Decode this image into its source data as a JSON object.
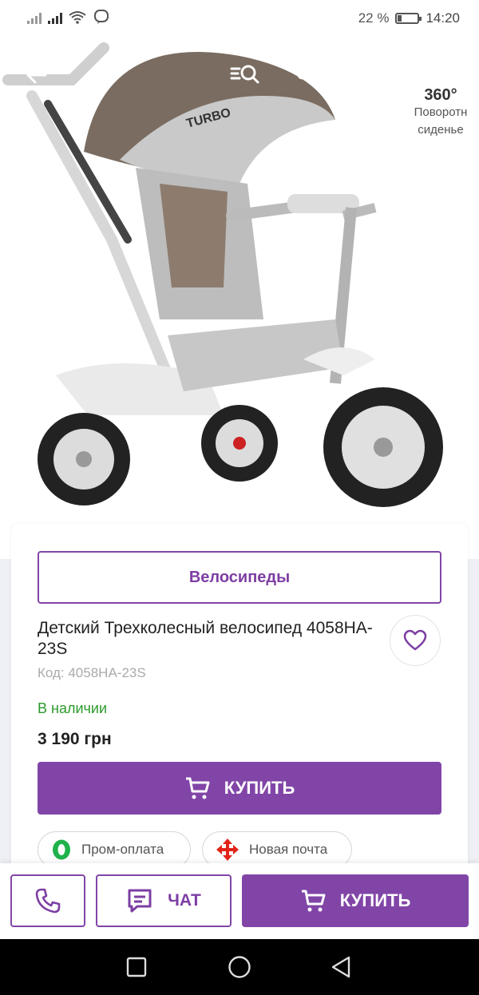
{
  "status_bar": {
    "battery_text": "22 %",
    "battery_level": 0.22,
    "time": "14:20"
  },
  "toolbar": {
    "back_icon": "arrow-left-icon",
    "filter_search_icon": "filter-search-icon",
    "share_icon": "share-icon",
    "cart_icon": "cart-icon",
    "message_icon": "message-icon"
  },
  "product_image": {
    "badge_deg": "360°",
    "badge_line1": "Поворотн",
    "badge_line2": "сиденье"
  },
  "product": {
    "category": "Велосипеды",
    "title": "Детский Трехколесный велосипед 4058HA-23S",
    "code": "Код: 4058HA-23S",
    "availability": "В наличии",
    "price": "3 190 грн",
    "buy_label": "КУПИТЬ"
  },
  "delivery": {
    "payment_label": "Пром-оплата",
    "shipping_label": "Новая почта"
  },
  "bottom_bar": {
    "chat_label": "ЧАТ",
    "buy_label": "КУПИТЬ"
  },
  "colors": {
    "accent": "#8145a7",
    "in_stock": "#2a9a2a",
    "nav_bg": "#000000"
  }
}
